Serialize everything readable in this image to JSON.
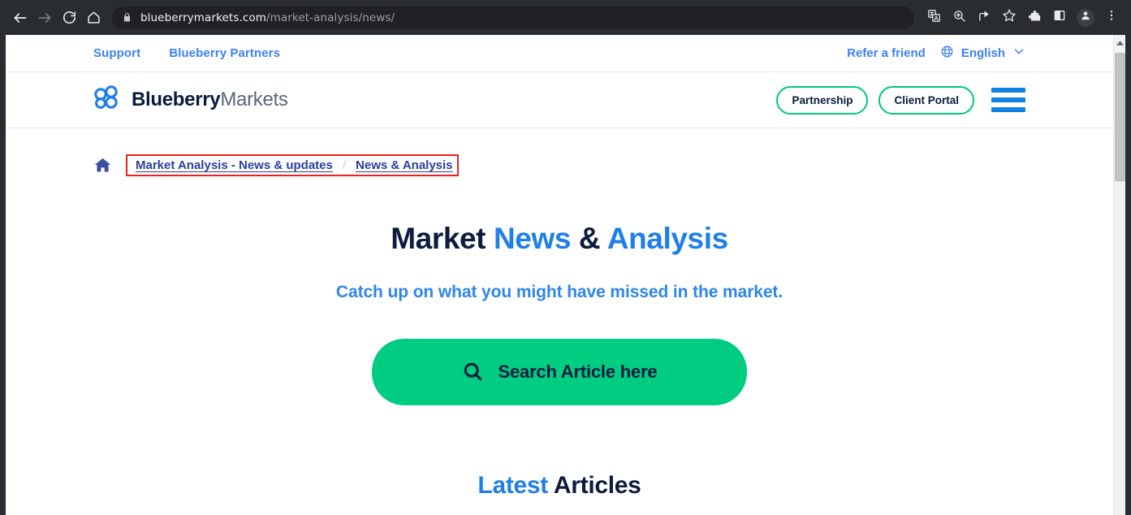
{
  "browser": {
    "back_icon": "back-arrow-icon",
    "forward_icon": "forward-arrow-icon",
    "reload_icon": "reload-icon",
    "home_icon": "home-icon",
    "lock_icon": "lock-icon",
    "url_domain": "blueberrymarkets.com",
    "url_path": "/market-analysis/news/",
    "toolbar_icons": [
      "translate-icon",
      "zoom-icon",
      "share-icon",
      "bookmark-star-icon",
      "extensions-puzzle-icon",
      "side-panel-icon",
      "profile-avatar-icon",
      "chrome-menu-icon"
    ]
  },
  "utility_bar": {
    "links": [
      {
        "label": "Support"
      },
      {
        "label": "Blueberry Partners"
      }
    ],
    "refer_label": "Refer a friend",
    "language": {
      "globe_icon": "globe-icon",
      "label": "English",
      "chevron_icon": "chevron-down-icon"
    }
  },
  "header": {
    "logo_icon": "blueberry-circles-logo-icon",
    "brand_primary": "Blueberry",
    "brand_secondary": "Markets",
    "buttons": [
      {
        "label": "Partnership"
      },
      {
        "label": "Client Portal"
      }
    ],
    "menu_icon": "hamburger-menu-icon"
  },
  "breadcrumb": {
    "home_icon": "home-icon",
    "separator": "/",
    "items": [
      {
        "label": "Market Analysis - News & updates"
      },
      {
        "label": "News & Analysis"
      }
    ],
    "highlight_color": "#ee2020"
  },
  "hero": {
    "title_part1": "Market ",
    "title_part2": "News",
    "title_part3": " & ",
    "title_part4": "Analysis",
    "subtitle": "Catch up on what you might have missed in the market.",
    "search_icon": "search-magnifier-icon",
    "search_label": "Search Article here"
  },
  "latest": {
    "part1": "Latest",
    "part2": " Articles"
  },
  "colors": {
    "brand_blue": "#1f7fe8",
    "brand_navy": "#0d1b3e",
    "accent_green": "#00cc82",
    "highlight_red": "#ee2020"
  },
  "scrollbar": {
    "up_arrow_icon": "scroll-up-arrow-icon"
  }
}
